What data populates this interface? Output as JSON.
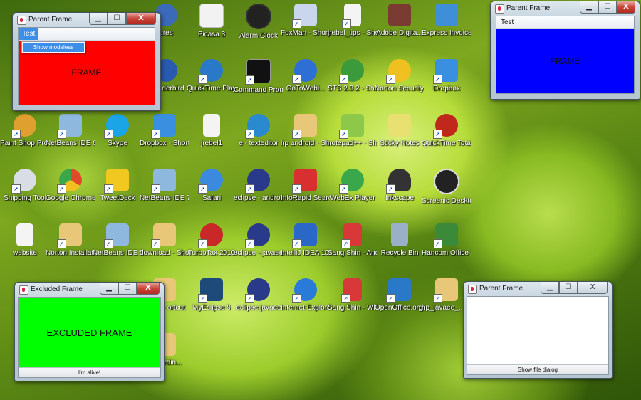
{
  "desktop": {
    "icons": [
      {
        "label": "Picasa 3",
        "color": "#f2f2f2"
      },
      {
        "label": "Alarm Clock",
        "color": "#222222"
      },
      {
        "label": "FoxMan - Shortcut",
        "color": "#c9d6ee"
      },
      {
        "label": "jrebel_tips - Shortcut",
        "color": "#f4f4f4"
      },
      {
        "label": "Adobe Digita...",
        "color": "#7a3c32"
      },
      {
        "label": "Express Invoice",
        "color": "#3f8ed8"
      },
      {
        "label": "QuickTime Player",
        "color": "#2a78c8"
      },
      {
        "label": "Command Prompt",
        "color": "#111111"
      },
      {
        "label": "GoToWebi...",
        "color": "#2e6fd6"
      },
      {
        "label": "STS 2.3.2 - Shortcut",
        "color": "#3b9a3b"
      },
      {
        "label": "Norton Security Scan",
        "color": "#f0c020"
      },
      {
        "label": "Dropbox",
        "color": "#3b8fe0"
      },
      {
        "label": "Paint Shop Pro 6",
        "color": "#e0a030"
      },
      {
        "label": "NetBeans IDE 6.9.1",
        "color": "#8fb8de"
      },
      {
        "label": "Skype",
        "color": "#19a5e6"
      },
      {
        "label": "Dropbox - Shortcut",
        "color": "#3b8fe0"
      },
      {
        "label": "jrebel1",
        "color": "#f4f4f4"
      },
      {
        "label": "e - texteditor",
        "color": "#2a8ad0"
      },
      {
        "label": "hp android - Shortcut",
        "color": "#e8c878"
      },
      {
        "label": "notepad++ - Shortcut",
        "color": "#8ec84a"
      },
      {
        "label": "Sticky Notes",
        "color": "#e8e070"
      },
      {
        "label": "QuickTime Total Video Conv...",
        "color": "#c0281c"
      },
      {
        "label": "Snipping Tool",
        "color": "#d8dde6"
      },
      {
        "label": "Google Chrome",
        "color": "#e04a2a"
      },
      {
        "label": "TweetDeck",
        "color": "#f0c820"
      },
      {
        "label": "NetBeans IDE 7.0",
        "color": "#8fb8de"
      },
      {
        "label": "Safari",
        "color": "#3b8ae0"
      },
      {
        "label": "eclipse - android",
        "color": "#2a3a8a"
      },
      {
        "label": "InfoRapid Search...",
        "color": "#d83030"
      },
      {
        "label": "WebEx Player",
        "color": "#3aa84a"
      },
      {
        "label": "Inkscape",
        "color": "#333333"
      },
      {
        "label": "Screenic Desktop 2",
        "color": "#222222"
      },
      {
        "label": "website",
        "color": "#f4f4f4"
      },
      {
        "label": "Norton Installati...",
        "color": "#e8c878"
      },
      {
        "label": "NetBeans IDE 7.0.1",
        "color": "#8fb8de"
      },
      {
        "label": "download - Shortcut",
        "color": "#e8c878"
      },
      {
        "label": "TurboTax 2010",
        "color": "#c82828"
      },
      {
        "label": "eclipse - javaee-gali...",
        "color": "#2a3a8a"
      },
      {
        "label": "IntelliJ IDEA 10.0.3",
        "color": "#2a68c8"
      },
      {
        "label": "Sang Shin - Android pr...",
        "color": "#d83838"
      },
      {
        "label": "Recycle Bin",
        "color": "#9ab0c8"
      },
      {
        "label": "Hancom Office View...",
        "color": "#3a8a3a"
      },
      {
        "label": "MyEclipse 9",
        "color": "#1e4a7a"
      },
      {
        "label": "eclipse javaee",
        "color": "#2a3a8a"
      },
      {
        "label": "Internet Explorer",
        "color": "#2a7ad8"
      },
      {
        "label": "Sang Shin - Whats new ...",
        "color": "#d83838"
      },
      {
        "label": "OpenOffice.org 3.1",
        "color": "#2a78c8"
      },
      {
        "label": "hp_javaee_... - Shortcut",
        "color": "#e8c878"
      },
      {
        "label": "ures",
        "color": "#3a6ab8"
      },
      {
        "label": "zilla derbird",
        "color": "#2a5ab0"
      },
      {
        "label": "dings - ortcut",
        "color": "#e8c878"
      },
      {
        "label": "work rdin...",
        "color": "#e8c878"
      }
    ]
  },
  "windows": {
    "parent1": {
      "title": "Parent Frame",
      "menu": "Test",
      "dropdown_item": "Show modeless",
      "panel_text": "FRAME",
      "panel_color": "#ff0000"
    },
    "parent2": {
      "title": "Parent Frame",
      "menu": "Test",
      "panel_text": "FRAME",
      "panel_color": "#0000ff"
    },
    "excluded": {
      "title": "Excluded Frame",
      "panel_text": "EXCLUDED FRAME",
      "panel_color": "#00ff00",
      "status": "I'm alive!"
    },
    "parent3": {
      "title": "Parent Frame",
      "status": "Show file dialog"
    }
  },
  "controls": {
    "minimize": "▁",
    "maximize": "☐",
    "close": "X"
  }
}
